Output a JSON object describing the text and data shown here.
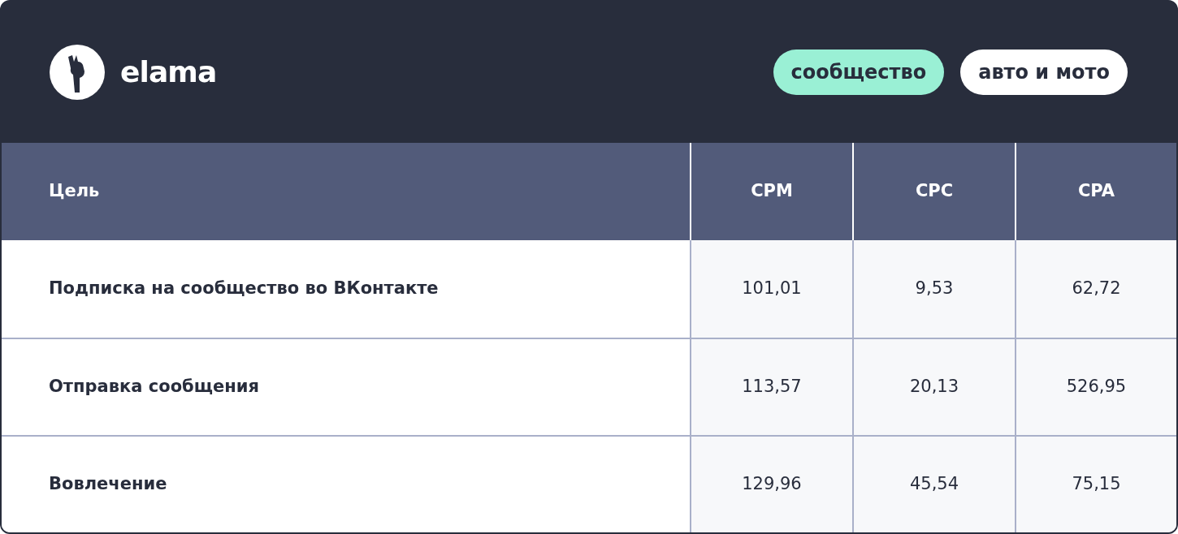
{
  "header": {
    "logo_text": "elama",
    "tags": [
      {
        "label": "сообщество",
        "color": "#9af0d5"
      },
      {
        "label": "авто и мото",
        "color": "#ffffff"
      }
    ]
  },
  "table": {
    "columns": [
      "Цель",
      "CPM",
      "CPC",
      "CPA"
    ],
    "rows": [
      [
        "Подписка на сообщество во ВКонтакте",
        "101,01",
        "9,53",
        "62,72"
      ],
      [
        "Отправка сообщения",
        "113,57",
        "20,13",
        "526,95"
      ],
      [
        "Вовлечение",
        "129,96",
        "45,54",
        "75,15"
      ]
    ]
  }
}
